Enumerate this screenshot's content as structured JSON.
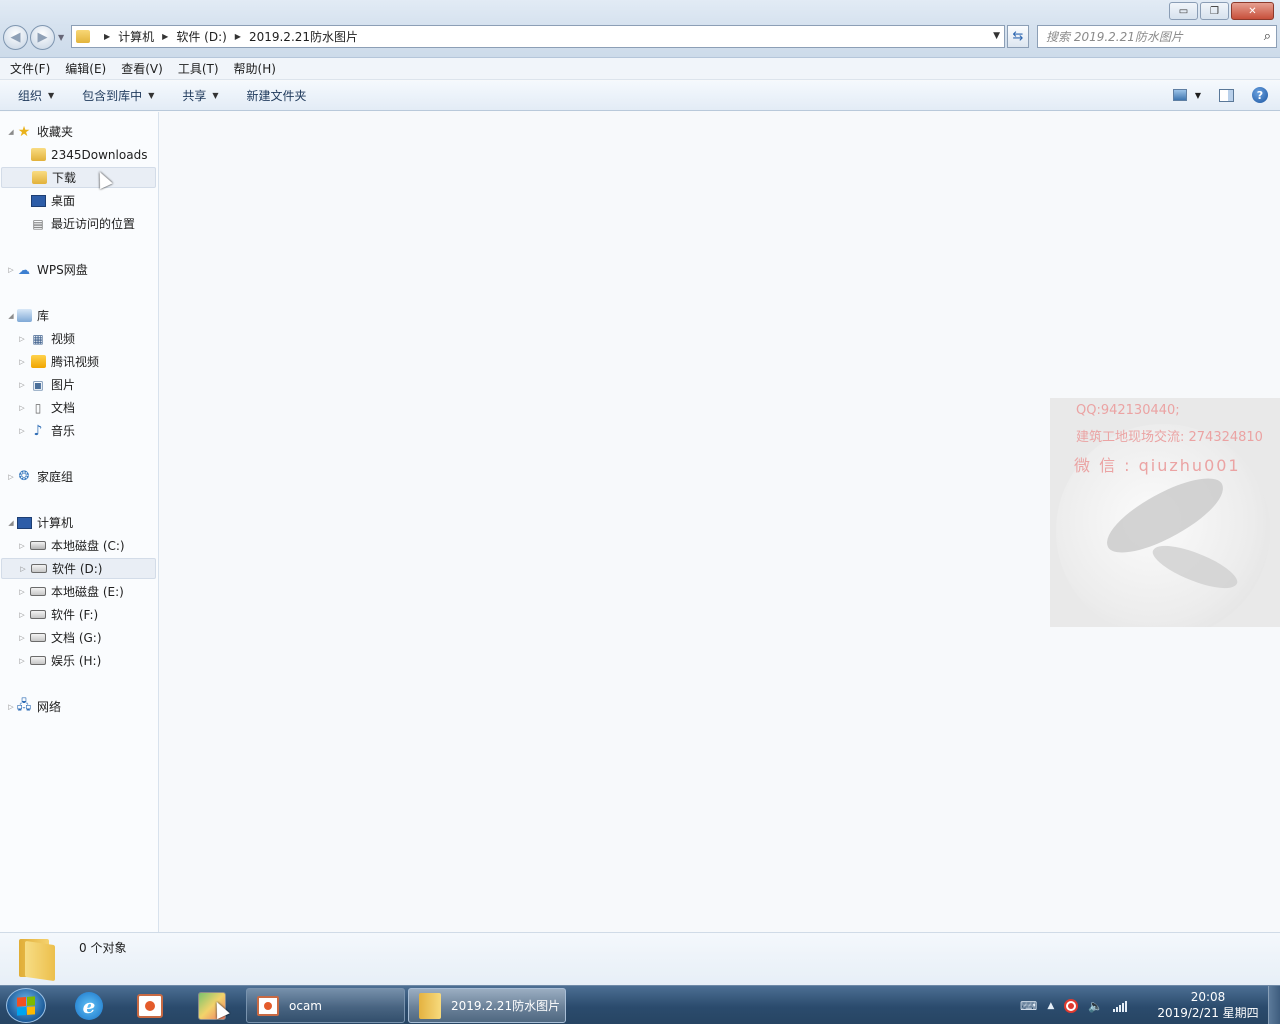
{
  "window": {
    "controls": {
      "minimize": "▭",
      "restore": "❐",
      "close": "✕"
    }
  },
  "address": {
    "crumbs": [
      "计算机",
      "软件 (D:)",
      "2019.2.21防水图片"
    ],
    "search_placeholder": "搜索 2019.2.21防水图片"
  },
  "menu": [
    "文件(F)",
    "编辑(E)",
    "查看(V)",
    "工具(T)",
    "帮助(H)"
  ],
  "toolbar": {
    "organize": "组织",
    "include_in_library": "包含到库中",
    "share": "共享",
    "new_folder": "新建文件夹",
    "help": "?"
  },
  "nav": {
    "favorites": "收藏夹",
    "fav_items": [
      "2345Downloads",
      "下载",
      "桌面",
      "最近访问的位置"
    ],
    "wps": "WPS网盘",
    "libraries": "库",
    "lib_items": [
      "视频",
      "腾讯视频",
      "图片",
      "文档",
      "音乐"
    ],
    "homegroup": "家庭组",
    "computer": "计算机",
    "drives": [
      "本地磁盘 (C:)",
      "软件 (D:)",
      "本地磁盘 (E:)",
      "软件 (F:)",
      "文档 (G:)",
      "娱乐 (H:)"
    ],
    "network": "网络"
  },
  "details": {
    "count_text": "0 个对象"
  },
  "watermark": {
    "line1": "QQ:942130440;",
    "line2": "建筑工地现场交流: 274324810",
    "line3": "微 信 : qiuzhu001"
  },
  "taskbar": {
    "tasks": [
      "ocam",
      "2019.2.21防水图片"
    ],
    "clock_time": "20:08",
    "clock_date": "2019/2/21 星期四"
  },
  "colors": {
    "accent": "#2e67b1",
    "selection": "#e9eef5",
    "taskbar": "#2b4b6d"
  }
}
